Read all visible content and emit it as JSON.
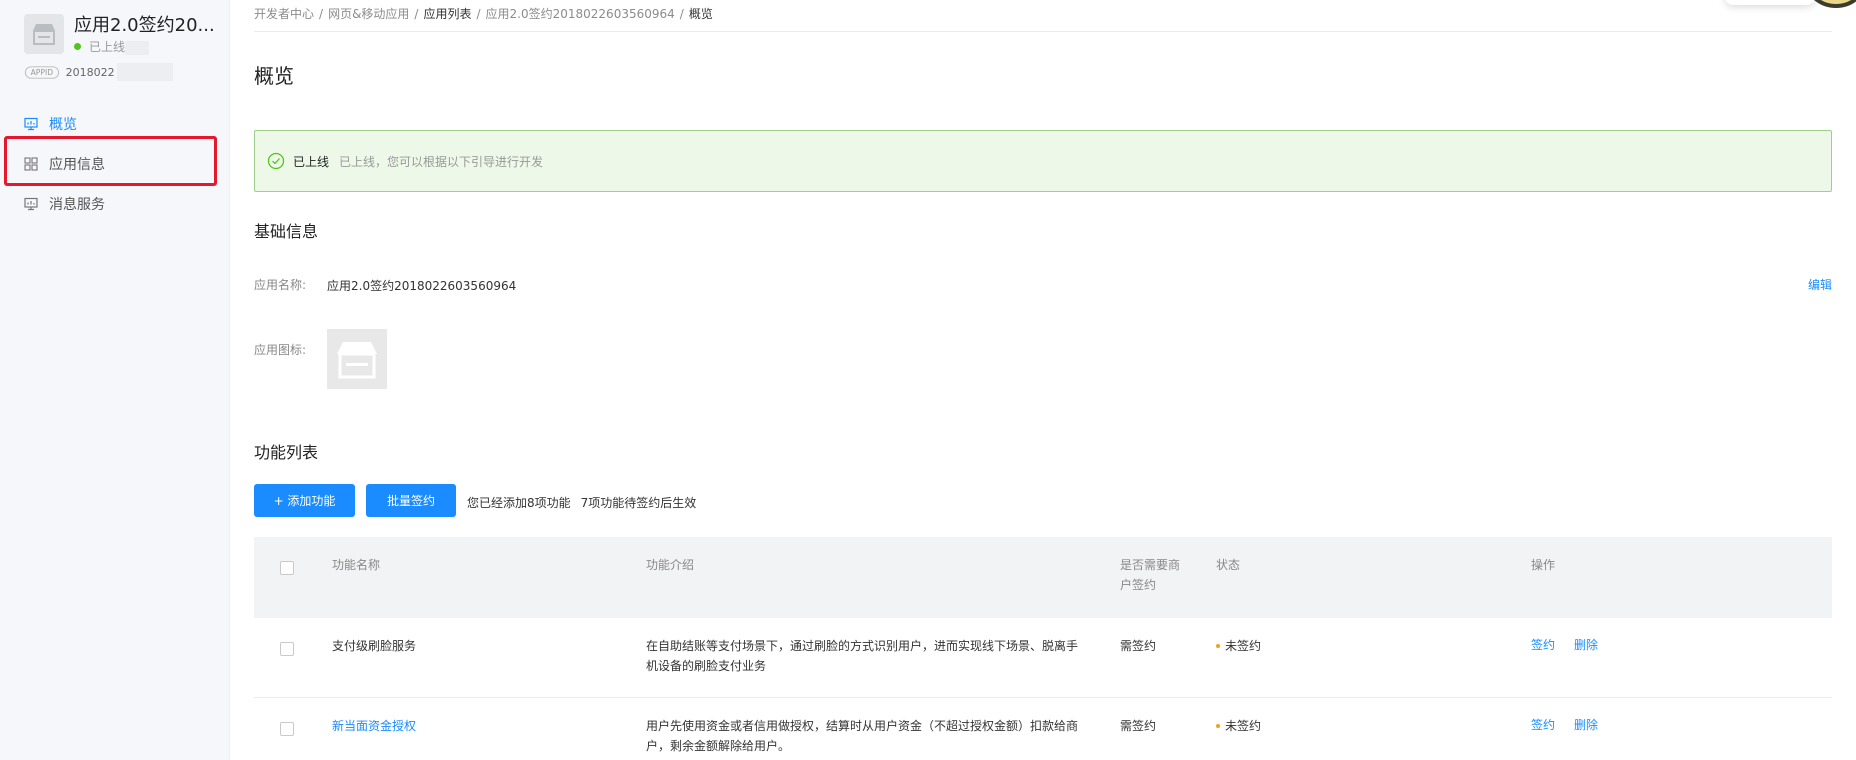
{
  "sidebar": {
    "app_title": "应用2.0签约20...",
    "app_status": "已上线",
    "appid_badge": "APPID",
    "appid_value": "2018022",
    "nav": [
      {
        "label": "概览",
        "icon": "monitor-icon",
        "active": true
      },
      {
        "label": "应用信息",
        "icon": "grid-icon",
        "active": false
      },
      {
        "label": "消息服务",
        "icon": "message-monitor-icon",
        "active": false
      }
    ]
  },
  "breadcrumb": [
    "开发者中心",
    "网页&移动应用",
    "应用列表",
    "应用2.0签约2018022603560964",
    "概览"
  ],
  "page_title": "概览",
  "alert": {
    "title": "已上线",
    "desc": "已上线，您可以根据以下引导进行开发"
  },
  "basic": {
    "title": "基础信息",
    "name_label": "应用名称:",
    "name_value": "应用2.0签约2018022603560964",
    "edit": "编辑",
    "icon_label": "应用图标:"
  },
  "features": {
    "title": "功能列表",
    "add_button": "+ 添加功能",
    "batch_button": "批量签约",
    "hint_added": "您已经添加8项功能",
    "hint_pending": "7项功能待签约后生效",
    "columns": {
      "name": "功能名称",
      "desc": "功能介绍",
      "need_sign_1": "是否需要商",
      "need_sign_2": "户签约",
      "status": "状态",
      "ops": "操作"
    },
    "rows": [
      {
        "name": "支付级刷脸服务",
        "desc_1": "在自助结账等支付场景下，通过刷脸的方式识别用户，进而实现线下场景、脱离手",
        "desc_2": "机设备的刷脸支付业务",
        "need_sign": "需签约",
        "status": "未签约",
        "op_sign": "签约",
        "op_delete": "删除"
      },
      {
        "name": "新当面资金授权",
        "desc_1": "用户先使用资金或者信用做授权，结算时从用户资金（不超过授权金额）扣款给商",
        "desc_2": "户，剩余金额解除给用户。",
        "need_sign": "需签约",
        "status": "未签约",
        "op_sign": "签约",
        "op_delete": "删除"
      }
    ]
  },
  "colors": {
    "primary": "#1a8cff",
    "success_bg": "#edf8e8",
    "success_border": "#9ed089",
    "highlight": "#e5192d",
    "pending_dot": "#f0a020"
  }
}
